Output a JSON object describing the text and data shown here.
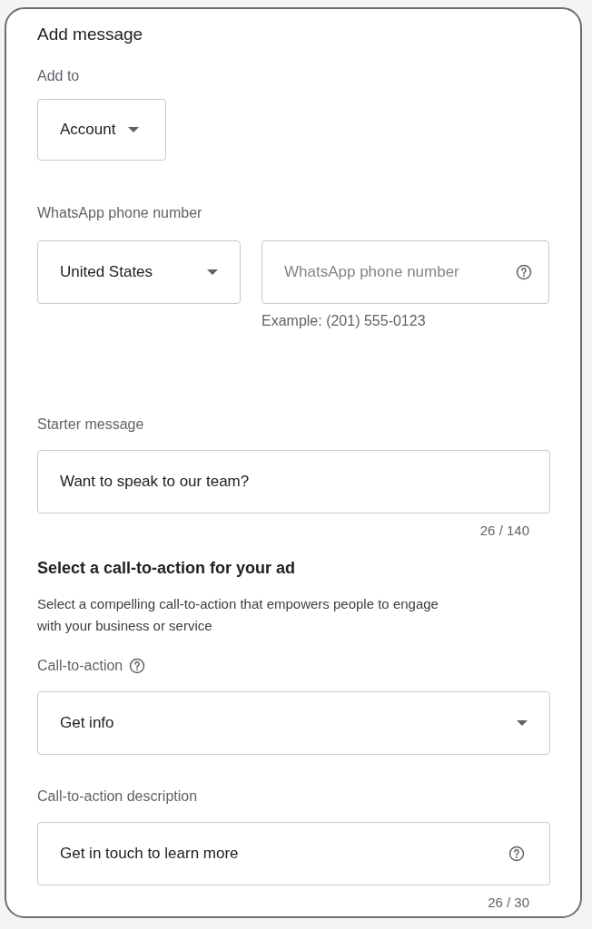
{
  "title": "Add message",
  "add_to": {
    "label": "Add to",
    "value": "Account"
  },
  "whatsapp": {
    "label": "WhatsApp phone number",
    "country": "United States",
    "phone_placeholder": "WhatsApp phone number",
    "hint": "Example: (201) 555-0123"
  },
  "starter": {
    "label": "Starter message",
    "value": "Want to speak to our team?",
    "count": "26 / 140"
  },
  "cta_section": {
    "heading": "Select a call-to-action for your ad",
    "description": "Select a compelling call-to-action that empowers people to engage with your business or service"
  },
  "cta": {
    "label": "Call-to-action",
    "value": "Get info"
  },
  "cta_description": {
    "label": "Call-to-action description",
    "value": "Get in touch to learn more",
    "count": "26 / 30"
  }
}
